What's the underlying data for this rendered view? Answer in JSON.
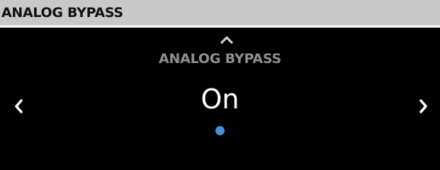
{
  "header": {
    "title": "ANALOG BYPASS"
  },
  "screen": {
    "parameter_label": "ANALOG BYPASS",
    "parameter_value": "On",
    "up_icon": "chevron-up-icon",
    "left_icon": "chevron-left-icon",
    "right_icon": "chevron-right-icon",
    "page_indicator": {
      "count": 1,
      "active_index": 0
    }
  },
  "colors": {
    "header_background": "#c8c8c8",
    "screen_background": "#000000",
    "label_text": "#8f8f8f",
    "value_text": "#ffffff",
    "indicator_active": "#4a8fd6",
    "arrow_color": "#ffffff",
    "up_arrow_color": "#cfcfcf"
  }
}
